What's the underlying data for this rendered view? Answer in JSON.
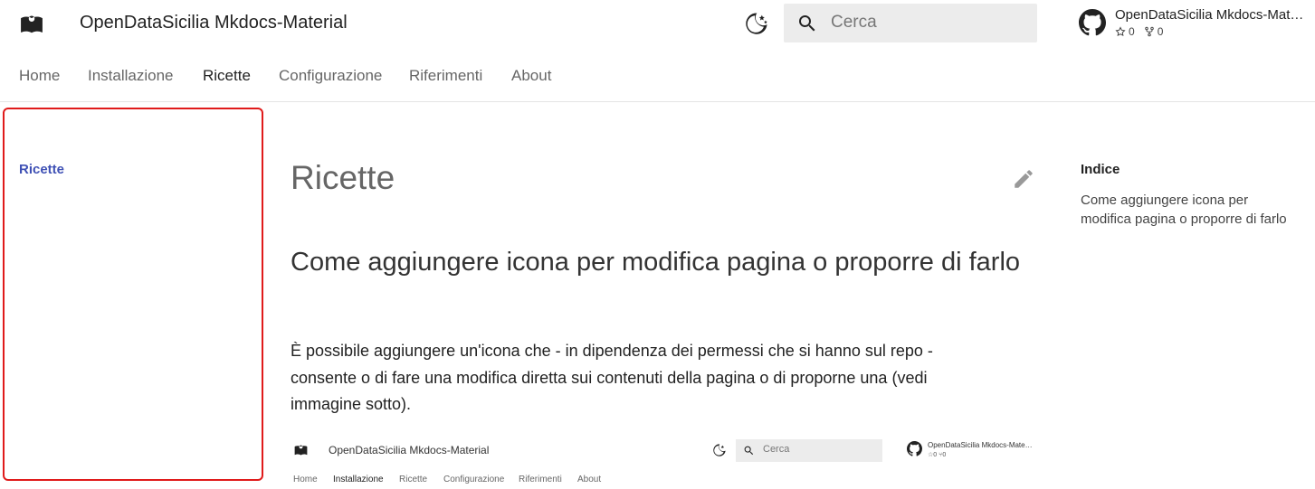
{
  "header": {
    "logo_icon": "book-reader-icon",
    "site_title": "OpenDataSicilia Mkdocs-Material",
    "theme_toggle_icon": "moon-stars-icon",
    "search": {
      "placeholder": "Cerca",
      "icon": "search-icon"
    },
    "repo": {
      "icon": "github-icon",
      "name": "OpenDataSicilia Mkdocs-Material",
      "stars": "0",
      "forks": "0"
    }
  },
  "tabs": [
    {
      "label": "Home",
      "active": false
    },
    {
      "label": "Installazione",
      "active": false
    },
    {
      "label": "Ricette",
      "active": true
    },
    {
      "label": "Configurazione",
      "active": false
    },
    {
      "label": "Riferimenti",
      "active": false
    },
    {
      "label": "About",
      "active": false
    }
  ],
  "sidebar": {
    "items": [
      {
        "label": "Ricette",
        "active": true
      }
    ],
    "highlight_color": "#e01b1b",
    "link_color": "#3f51b5"
  },
  "content": {
    "title": "Ricette",
    "edit_icon": "pencil-icon",
    "section_heading": "Come aggiungere icona per modifica pagina o proporre di farlo",
    "paragraph": "È possibile aggiungere un'icona che - in dipendenza dei permessi che si hanno sul repo - consente o di fare una modifica diretta sui contenuti della pagina o di proporne una (vedi immagine sotto).",
    "embedded_screenshot": {
      "site_title": "OpenDataSicilia Mkdocs-Material",
      "search_placeholder": "Cerca",
      "repo_name": "OpenDataSicilia Mkdocs-Material",
      "repo_stats": "☆0  ⑂0",
      "tabs": [
        "Home",
        "Installazione",
        "Ricette",
        "Configurazione",
        "Riferimenti",
        "About"
      ],
      "active_tab": "Installazione"
    }
  },
  "toc": {
    "title": "Indice",
    "items": [
      {
        "label": "Come aggiungere icona per modifica pagina o proporre di farlo"
      }
    ]
  }
}
